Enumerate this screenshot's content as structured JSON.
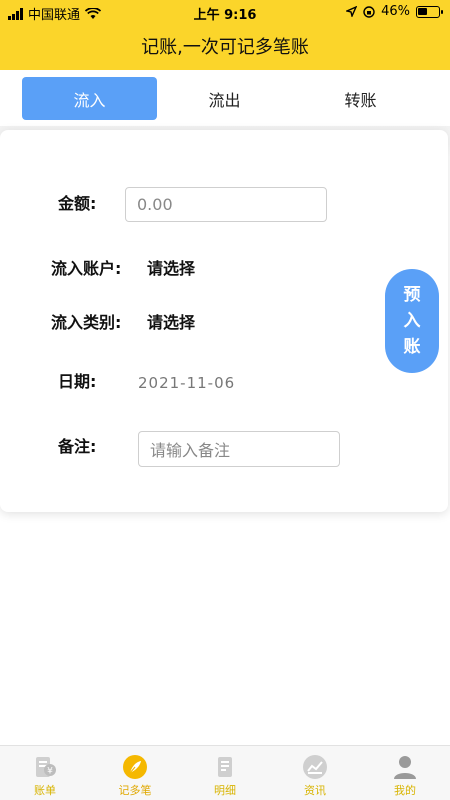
{
  "status_bar": {
    "carrier": "中国联通",
    "time": "上午 9:16",
    "battery": "46%",
    "battery_level": 0.46
  },
  "header": {
    "title": "记账,一次可记多笔账"
  },
  "tabs": [
    {
      "label": "流入",
      "active": true
    },
    {
      "label": "流出",
      "active": false
    },
    {
      "label": "转账",
      "active": false
    }
  ],
  "form": {
    "amount_label": "金额:",
    "amount_placeholder": "0.00",
    "account_label": "流入账户:",
    "account_value": "请选择",
    "category_label": "流入类别:",
    "category_value": "请选择",
    "date_label": "日期:",
    "date_value": "2021-11-06",
    "note_label": "备注:",
    "note_placeholder": "请输入备注"
  },
  "fab": {
    "chars": [
      "预",
      "入",
      "账"
    ]
  },
  "bottom_nav": [
    {
      "label": "账单",
      "icon": "bill-icon"
    },
    {
      "label": "记多笔",
      "icon": "feather-icon",
      "active": true
    },
    {
      "label": "明细",
      "icon": "detail-icon"
    },
    {
      "label": "资讯",
      "icon": "chart-icon"
    },
    {
      "label": "我的",
      "icon": "user-icon"
    }
  ],
  "colors": {
    "header_yellow": "#fbd52a",
    "accent_blue": "#5aa0f7",
    "nav_active": "#f5b800"
  }
}
